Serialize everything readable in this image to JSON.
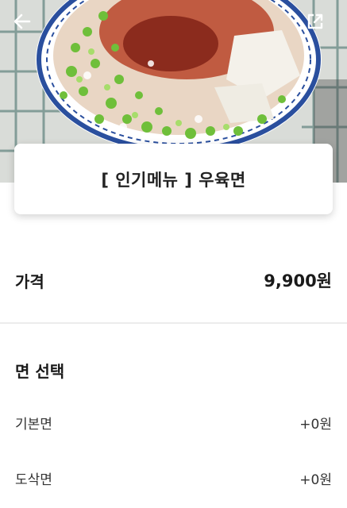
{
  "header": {
    "back_icon": "arrow-left-icon",
    "share_icon": "share-external-icon"
  },
  "menu": {
    "title": "[ 인기메뉴 ] 우육면"
  },
  "price": {
    "label": "가격",
    "value": "9,900원"
  },
  "noodle_section": {
    "title": "면 선택",
    "options": [
      {
        "label": "기본면",
        "price": "+0원"
      },
      {
        "label": "도삭면",
        "price": "+0원"
      }
    ]
  },
  "colors": {
    "bowl_blue": "#2a4f9e",
    "broth": "#c9662f",
    "scallion": "#6fbf3a"
  }
}
